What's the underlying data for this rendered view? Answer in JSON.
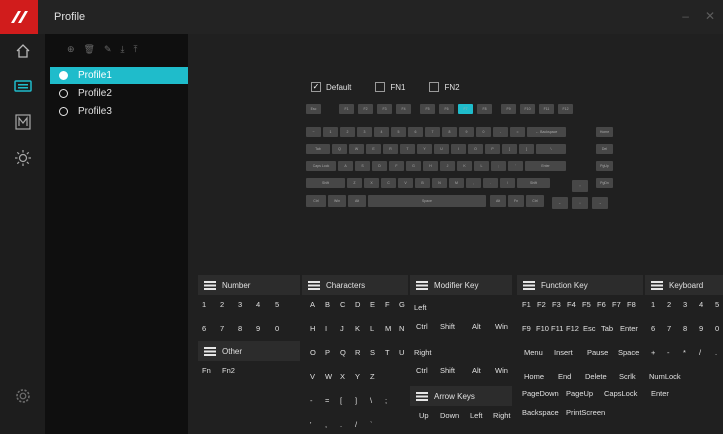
{
  "app": {
    "title": "Profile",
    "window_controls": {
      "minimize": "–",
      "close": "✕"
    }
  },
  "theme": {
    "accent": "#1fbccb",
    "brand": "#d11c1c"
  },
  "rail_icons": [
    "home-icon",
    "keyboard-icon",
    "macro-icon",
    "brightness-icon",
    "settings-icon"
  ],
  "profile_toolbar_icons": [
    "add-icon",
    "delete-icon",
    "edit-icon",
    "import-icon",
    "export-icon"
  ],
  "profiles": [
    {
      "label": "Profile1",
      "selected": true
    },
    {
      "label": "Profile2",
      "selected": false
    },
    {
      "label": "Profile3",
      "selected": false
    }
  ],
  "layers": [
    {
      "label": "Default",
      "checked": true
    },
    {
      "label": "FN1",
      "checked": false
    },
    {
      "label": "FN2",
      "checked": false
    }
  ],
  "keyboard_rows": [
    [
      "Esc",
      "F1",
      "F2",
      "F3",
      "F4",
      "F5",
      "F6",
      "F7",
      "F8",
      "F9",
      "F10",
      "F11",
      "F12"
    ],
    [
      "~",
      "1",
      "2",
      "3",
      "4",
      "5",
      "6",
      "7",
      "8",
      "9",
      "0",
      "-",
      "=",
      "← Backspace",
      "Home"
    ],
    [
      "Tab",
      "Q",
      "W",
      "E",
      "R",
      "T",
      "Y",
      "U",
      "I",
      "O",
      "P",
      "[",
      "]",
      "\\",
      "Del"
    ],
    [
      "Caps Lock",
      "A",
      "S",
      "D",
      "F",
      "G",
      "H",
      "J",
      "K",
      "L",
      ";",
      "'",
      "Enter",
      "PgUp"
    ],
    [
      "Shift",
      "Z",
      "X",
      "C",
      "V",
      "B",
      "N",
      "M",
      ",",
      ".",
      "/",
      "Shift",
      "↑",
      "PgDn"
    ],
    [
      "Ctrl",
      "Win",
      "Alt",
      "Space",
      "Alt",
      "Fn",
      "Ctrl",
      "←",
      "↓",
      "→"
    ]
  ],
  "key_panels": {
    "number": {
      "title": "Number",
      "keys": [
        "1",
        "2",
        "3",
        "4",
        "5",
        "6",
        "7",
        "8",
        "9",
        "0"
      ]
    },
    "other": {
      "title": "Other",
      "keys": [
        "Fn",
        "Fn2"
      ]
    },
    "characters": {
      "title": "Characters",
      "keys": [
        "A",
        "B",
        "C",
        "D",
        "E",
        "F",
        "G",
        "H",
        "I",
        "J",
        "K",
        "L",
        "M",
        "N",
        "O",
        "P",
        "Q",
        "R",
        "S",
        "T",
        "U",
        "V",
        "W",
        "X",
        "Y",
        "Z",
        "-",
        "=",
        "[",
        "]",
        "\\",
        ";",
        "'",
        ",",
        ".",
        "/",
        "`"
      ]
    },
    "modifier": {
      "title": "Modifier Key",
      "left_label": "Left",
      "left_keys": [
        "Ctrl",
        "Shift",
        "Alt",
        "Win"
      ],
      "right_label": "Right",
      "right_keys": [
        "Ctrl",
        "Shift",
        "Alt",
        "Win"
      ]
    },
    "arrow": {
      "title": "Arrow Keys",
      "keys": [
        "Up",
        "Down",
        "Left",
        "Right"
      ]
    },
    "function": {
      "title": "Function Key",
      "rows": [
        [
          "F1",
          "F2",
          "F3",
          "F4",
          "F5",
          "F6",
          "F7",
          "F8"
        ],
        [
          "F9",
          "F10",
          "F11",
          "F12",
          "Esc",
          "Tab",
          "Enter"
        ],
        [
          "Menu",
          "Insert",
          "Pause",
          "Space"
        ],
        [
          "Home",
          "End",
          "Delete",
          "Scrlk",
          "NumLock"
        ],
        [
          "PageDown",
          "PageUp",
          "CapsLock",
          "Enter"
        ],
        [
          "Backspace",
          "PrintScreen"
        ]
      ]
    },
    "keyboard": {
      "title": "Keyboard",
      "keys": [
        "1",
        "2",
        "3",
        "4",
        "5",
        "6",
        "7",
        "8",
        "9",
        "0",
        "+",
        "-",
        "*",
        "/",
        "."
      ]
    }
  }
}
